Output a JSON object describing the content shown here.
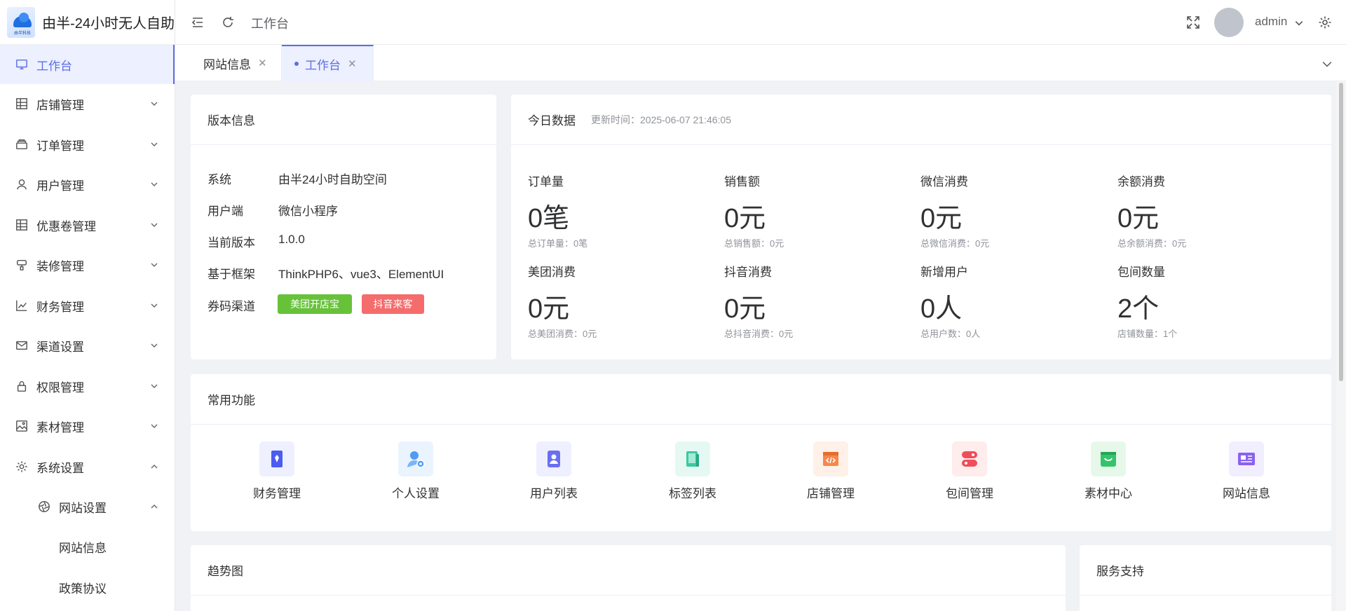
{
  "app": {
    "title": "由半-24小时无人自助",
    "logo_text": "由半科技"
  },
  "sidebar": {
    "items": [
      {
        "label": "工作台",
        "icon": "monitor-icon"
      },
      {
        "label": "店铺管理",
        "icon": "grid-icon"
      },
      {
        "label": "订单管理",
        "icon": "layers-icon"
      },
      {
        "label": "用户管理",
        "icon": "user-icon"
      },
      {
        "label": "优惠卷管理",
        "icon": "grid-icon"
      },
      {
        "label": "装修管理",
        "icon": "brush-icon"
      },
      {
        "label": "财务管理",
        "icon": "chart-icon"
      },
      {
        "label": "渠道设置",
        "icon": "mail-icon"
      },
      {
        "label": "权限管理",
        "icon": "lock-icon"
      },
      {
        "label": "素材管理",
        "icon": "image-icon"
      },
      {
        "label": "系统设置",
        "icon": "gear-icon"
      }
    ],
    "sub": {
      "label": "网站设置",
      "icon": "aperture-icon"
    },
    "sub_items": [
      {
        "label": "网站信息"
      },
      {
        "label": "政策协议"
      }
    ]
  },
  "header": {
    "title": "工作台",
    "username": "admin"
  },
  "tabs": [
    {
      "label": "网站信息",
      "active": false
    },
    {
      "label": "工作台",
      "active": true
    }
  ],
  "version": {
    "title": "版本信息",
    "rows": [
      {
        "k": "系统",
        "v": "由半24小时自助空间"
      },
      {
        "k": "用户端",
        "v": "微信小程序"
      },
      {
        "k": "当前版本",
        "v": "1.0.0"
      },
      {
        "k": "基于框架",
        "v": "ThinkPHP6、vue3、ElementUI"
      },
      {
        "k": "券码渠道",
        "v": ""
      }
    ],
    "tags": [
      {
        "label": "美团开店宝",
        "color": "#67c23a"
      },
      {
        "label": "抖音来客",
        "color": "#f56c6c"
      }
    ]
  },
  "today": {
    "title": "今日数据",
    "updated": "更新时间：2025-06-07 21:46:05",
    "stats": [
      {
        "label": "订单量",
        "value": "0笔",
        "total": "总订单量：0笔"
      },
      {
        "label": "销售额",
        "value": "0元",
        "total": "总销售额：0元"
      },
      {
        "label": "微信消费",
        "value": "0元",
        "total": "总微信消费：0元"
      },
      {
        "label": "余额消费",
        "value": "0元",
        "total": "总余额消费：0元"
      },
      {
        "label": "美团消费",
        "value": "0元",
        "total": "总美团消费：0元"
      },
      {
        "label": "抖音消费",
        "value": "0元",
        "total": "总抖音消费：0元"
      },
      {
        "label": "新增用户",
        "value": "0人",
        "total": "总用户数：0人"
      },
      {
        "label": "包间数量",
        "value": "2个",
        "total": "店铺数量：1个"
      }
    ]
  },
  "quick": {
    "title": "常用功能",
    "items": [
      {
        "label": "财务管理",
        "icon": "finance-icon",
        "bg": "#eef0ff",
        "fg": "#4b5cf0"
      },
      {
        "label": "个人设置",
        "icon": "user-settings-icon",
        "bg": "#eaf4ff",
        "fg": "#4f9cf5"
      },
      {
        "label": "用户列表",
        "icon": "user-list-icon",
        "bg": "#eef0ff",
        "fg": "#6a6ff0"
      },
      {
        "label": "标签列表",
        "icon": "tag-list-icon",
        "bg": "#e6f8f2",
        "fg": "#3cc9a0"
      },
      {
        "label": "店铺管理",
        "icon": "store-icon",
        "bg": "#fff1e8",
        "fg": "#f5884a"
      },
      {
        "label": "包间管理",
        "icon": "room-icon",
        "bg": "#ffecec",
        "fg": "#f04d5a"
      },
      {
        "label": "素材中心",
        "icon": "bag-icon",
        "bg": "#e6f8ea",
        "fg": "#34c46a"
      },
      {
        "label": "网站信息",
        "icon": "id-card-icon",
        "bg": "#f1eeff",
        "fg": "#8a62f0"
      }
    ]
  },
  "trend": {
    "title": "趋势图"
  },
  "support": {
    "title": "服务支持"
  }
}
